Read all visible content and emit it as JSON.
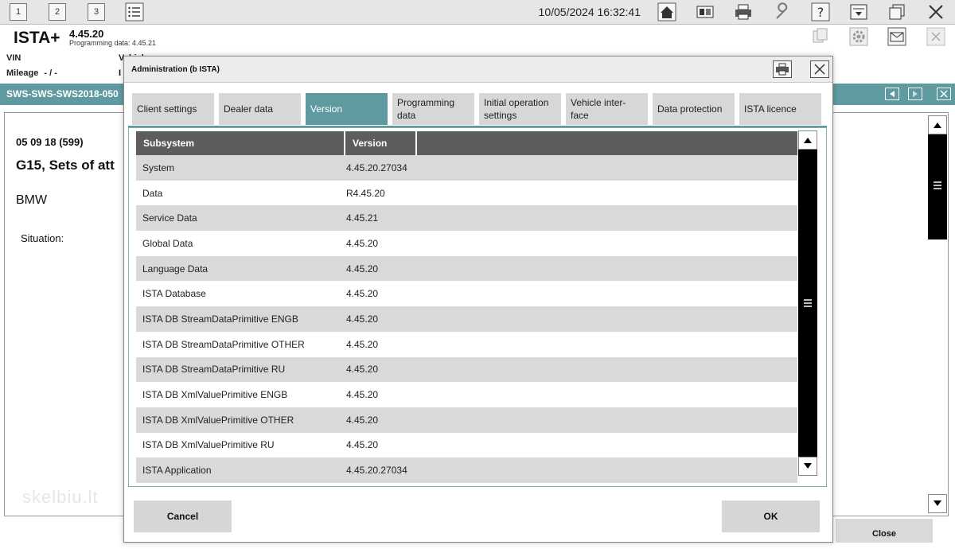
{
  "toolbar": {
    "buttons": [
      "1",
      "2",
      "3"
    ],
    "datetime": "10/05/2024 16:32:41"
  },
  "header": {
    "app_name": "ISTA+",
    "version": "4.45.20",
    "programming_data": "Programming data:  4.45.21",
    "vin_label": "VIN",
    "vehicle_label": "Vehicle",
    "mileage_label": "Mileage",
    "mileage_value": "- / -",
    "mileage_tail": "I"
  },
  "bluebar": {
    "title": "SWS-SWS-SWS2018-050"
  },
  "background": {
    "line1": "05 09 18 (599)",
    "line2": "G15, Sets of att",
    "line3": "BMW",
    "line4": "Situation:",
    "close_label": "Close",
    "watermark": "skelbiu.lt"
  },
  "dialog": {
    "title": "Administration (b ISTA)",
    "tabs": [
      {
        "label": "Client settings"
      },
      {
        "label": "Dealer data"
      },
      {
        "label": "Version"
      },
      {
        "label": "Programming data"
      },
      {
        "label": "Initial operation settings"
      },
      {
        "label": "Vehicle inter-face"
      },
      {
        "label": "Data protection"
      },
      {
        "label": "ISTA licence"
      }
    ],
    "table": {
      "headers": [
        "Subsystem",
        "Version"
      ],
      "rows": [
        [
          "System",
          "4.45.20.27034"
        ],
        [
          "Data",
          "R4.45.20"
        ],
        [
          "Service Data",
          "4.45.21"
        ],
        [
          "Global Data",
          "4.45.20"
        ],
        [
          "Language Data",
          "4.45.20"
        ],
        [
          "ISTA Database",
          "4.45.20"
        ],
        [
          "ISTA DB StreamDataPrimitive ENGB",
          "4.45.20"
        ],
        [
          "ISTA DB StreamDataPrimitive OTHER",
          "4.45.20"
        ],
        [
          "ISTA DB StreamDataPrimitive RU",
          "4.45.20"
        ],
        [
          "ISTA DB XmlValuePrimitive ENGB",
          "4.45.20"
        ],
        [
          "ISTA DB XmlValuePrimitive OTHER",
          "4.45.20"
        ],
        [
          "ISTA DB XmlValuePrimitive RU",
          "4.45.20"
        ],
        [
          "ISTA Application",
          "4.45.20.27034"
        ]
      ]
    },
    "cancel_label": "Cancel",
    "ok_label": "OK"
  },
  "colors": {
    "accent": "#5f9aa1",
    "header_bg": "#5d5d5d",
    "row_alt": "#d9d9d9"
  }
}
